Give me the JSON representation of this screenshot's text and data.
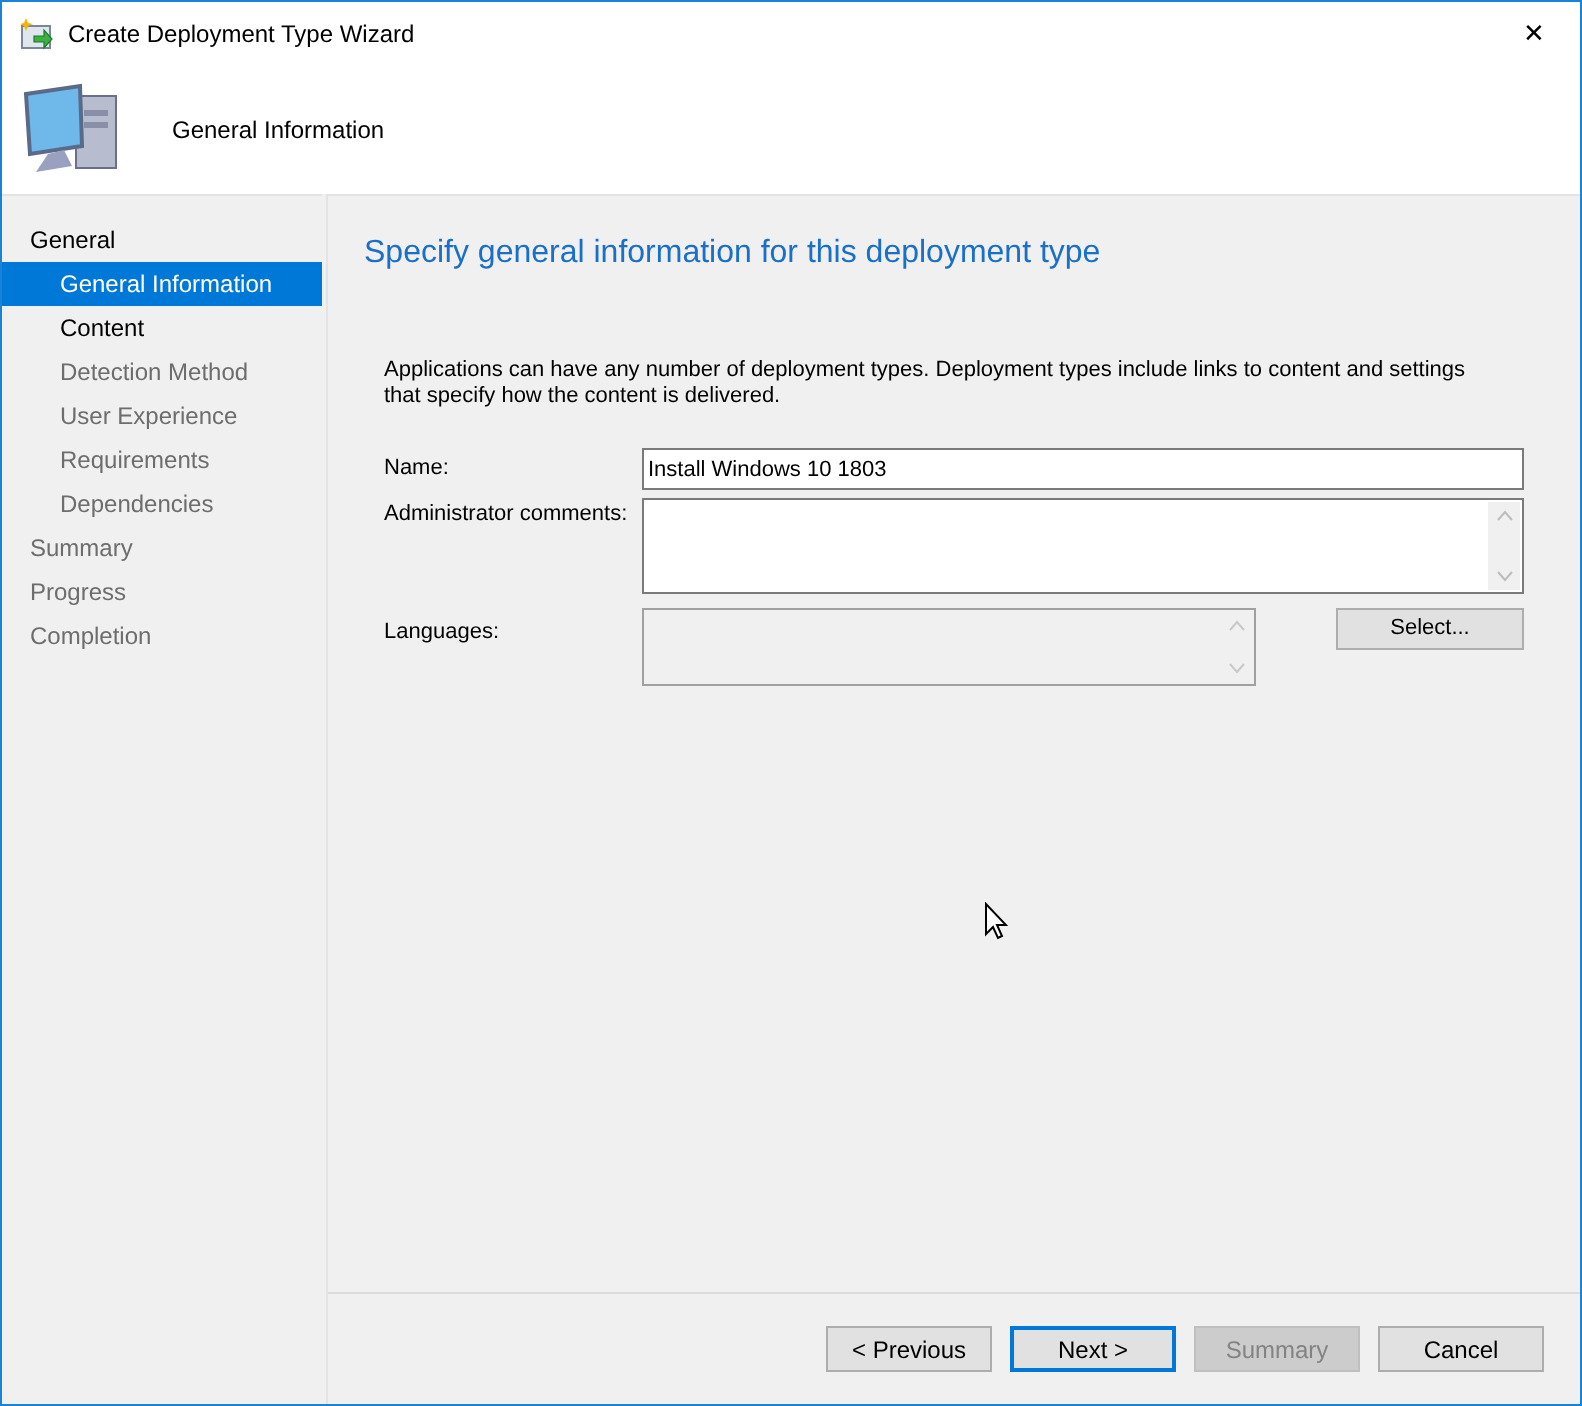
{
  "window": {
    "title": "Create Deployment Type Wizard",
    "close": "✕"
  },
  "header": {
    "title": "General Information"
  },
  "sidebar": {
    "items": [
      {
        "label": "General",
        "selected": false,
        "disabled": false,
        "children": [
          {
            "label": "General Information",
            "selected": true,
            "disabled": false
          },
          {
            "label": "Content",
            "selected": false,
            "disabled": false
          },
          {
            "label": "Detection Method",
            "selected": false,
            "disabled": true
          },
          {
            "label": "User Experience",
            "selected": false,
            "disabled": true
          },
          {
            "label": "Requirements",
            "selected": false,
            "disabled": true
          },
          {
            "label": "Dependencies",
            "selected": false,
            "disabled": true
          }
        ]
      },
      {
        "label": "Summary",
        "selected": false,
        "disabled": true
      },
      {
        "label": "Progress",
        "selected": false,
        "disabled": true
      },
      {
        "label": "Completion",
        "selected": false,
        "disabled": true
      }
    ]
  },
  "page": {
    "heading": "Specify general information for this deployment type",
    "description": "Applications can have any number of deployment types. Deployment types include links to content and settings that specify how the content is delivered.",
    "name": {
      "label": "Name:",
      "value": "Install Windows 10 1803"
    },
    "comments": {
      "label": "Administrator comments:"
    },
    "languages": {
      "label": "Languages:",
      "button": "Select..."
    }
  },
  "buttons": [
    {
      "label": "< Previous",
      "disabled": false,
      "default": false
    },
    {
      "label": "Next >",
      "disabled": false,
      "default": true
    },
    {
      "label": "Summary",
      "disabled": true,
      "default": false
    },
    {
      "label": "Cancel",
      "disabled": false,
      "default": false
    }
  ]
}
